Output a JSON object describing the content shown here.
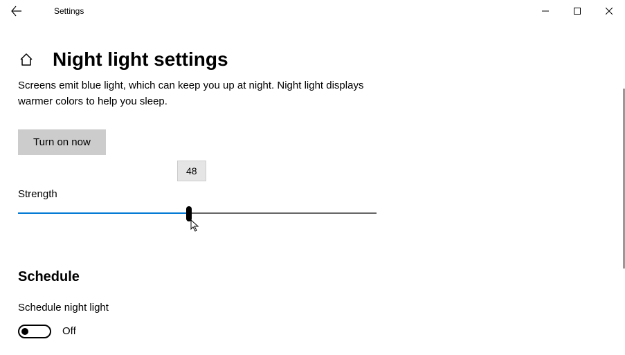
{
  "window": {
    "title": "Settings"
  },
  "page": {
    "title": "Night light settings",
    "description": "Screens emit blue light, which can keep you up at night. Night light displays warmer colors to help you sleep."
  },
  "buttons": {
    "turn_on": "Turn on now"
  },
  "strength": {
    "label": "Strength",
    "value": "48"
  },
  "schedule": {
    "heading": "Schedule",
    "toggle_label": "Schedule night light",
    "toggle_state": "Off"
  }
}
